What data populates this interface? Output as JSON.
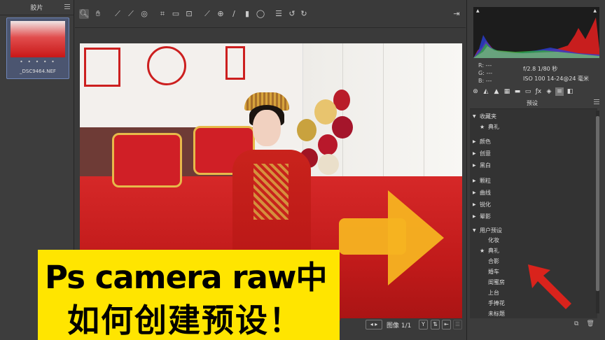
{
  "filmstrip": {
    "title": "胶片",
    "thumb_rating": "• • • • •",
    "thumb_filename": "_DSC9464.NEF"
  },
  "toolbar": {
    "tools": [
      "zoom-icon",
      "hand-icon",
      "white-balance-icon",
      "color-sampler-icon",
      "target-adjust-icon",
      "crop-icon",
      "straighten-icon",
      "transform-icon",
      "spot-removal-icon",
      "red-eye-icon",
      "brush-icon",
      "graduated-filter-icon",
      "radial-filter-icon",
      "preferences-icon",
      "rotate-left-icon",
      "rotate-right-icon",
      "fullscreen-icon"
    ]
  },
  "caption": {
    "line1": "Ps camera raw中",
    "line2": "如何创建预设！"
  },
  "status": {
    "image_count": "图像 1/1",
    "btn_y": "Y"
  },
  "meta": {
    "r": "R:   ---",
    "g": "G:   ---",
    "b": "B:   ---",
    "aperture_shutter": "f/2.8   1/80 秒",
    "iso_lens": "ISO 100   14-24@24 毫米"
  },
  "panel": {
    "section_title": "预设",
    "tree": [
      {
        "type": "folder",
        "open": true,
        "label": "收藏夹"
      },
      {
        "type": "item",
        "star": true,
        "label": "典礼"
      },
      {
        "type": "folder",
        "open": false,
        "label": "颜色"
      },
      {
        "type": "folder",
        "open": false,
        "label": "创意"
      },
      {
        "type": "folder",
        "open": false,
        "label": "黑白"
      },
      {
        "type": "folder",
        "open": false,
        "label": "颗粒"
      },
      {
        "type": "folder",
        "open": false,
        "label": "曲线"
      },
      {
        "type": "folder",
        "open": false,
        "label": "锐化"
      },
      {
        "type": "folder",
        "open": false,
        "label": "晕影"
      },
      {
        "type": "folder",
        "open": true,
        "label": "用户预设"
      },
      {
        "type": "item",
        "star": false,
        "label": "化妆"
      },
      {
        "type": "item",
        "star": true,
        "label": "典礼"
      },
      {
        "type": "item",
        "star": false,
        "label": "合影"
      },
      {
        "type": "item",
        "star": false,
        "label": "婚车"
      },
      {
        "type": "item",
        "star": false,
        "label": "闺蜜房"
      },
      {
        "type": "item",
        "star": false,
        "label": "上台"
      },
      {
        "type": "item",
        "star": false,
        "label": "手捧花"
      },
      {
        "type": "item",
        "star": false,
        "label": "未标题"
      }
    ]
  },
  "colors": {
    "accent_yellow": "#ffe500",
    "arrow_orange": "#f5b321",
    "arrow_red": "#d9231c"
  }
}
